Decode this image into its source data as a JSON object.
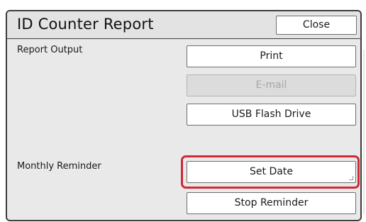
{
  "dialog": {
    "title": "ID Counter Report",
    "close_label": "Close"
  },
  "report_output": {
    "label": "Report Output",
    "buttons": [
      {
        "label": "Print",
        "enabled": true
      },
      {
        "label": "E-mail",
        "enabled": false
      },
      {
        "label": "USB Flash Drive",
        "enabled": true
      }
    ]
  },
  "monthly_reminder": {
    "label": "Monthly Reminder",
    "buttons": [
      {
        "label": "Set Date",
        "enabled": true,
        "highlighted": true
      },
      {
        "label": "Stop Reminder",
        "enabled": true
      }
    ]
  },
  "colors": {
    "panel_background": "#e9e9e9",
    "highlight": "#cf2a36",
    "disabled_text": "#a6a6a6"
  }
}
